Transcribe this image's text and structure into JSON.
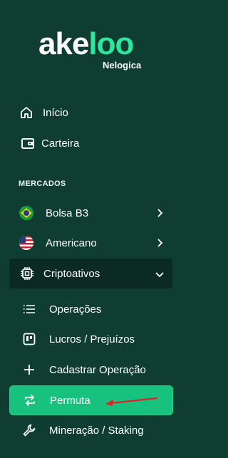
{
  "brand": {
    "logo_word_a": "ake",
    "logo_word_b": "loo",
    "logo_sub": "Nelogica",
    "accent": "#2ee59d"
  },
  "nav": {
    "inicio": {
      "label": "Início",
      "icon": "home-icon"
    },
    "carteira": {
      "label": "Carteira",
      "icon": "wallet-icon"
    }
  },
  "mercados": {
    "title": "MERCADOS",
    "items": [
      {
        "label": "Bolsa B3",
        "icon": "brazil-flag-icon"
      },
      {
        "label": "Americano",
        "icon": "usa-flag-icon"
      },
      {
        "label": "Criptoativos",
        "icon": "chip-icon"
      }
    ]
  },
  "crypto_sub": [
    {
      "label": "Operações",
      "icon": "list-icon"
    },
    {
      "label": "Lucros / Prejuízos",
      "icon": "board-icon"
    },
    {
      "label": "Cadastrar Operação",
      "icon": "plus-icon"
    },
    {
      "label": "Permuta",
      "icon": "swap-icon"
    },
    {
      "label": "Mineração / Staking",
      "icon": "wrench-icon"
    }
  ],
  "colors": {
    "background": "#0f3d31",
    "active_item": "#17c27f",
    "expanded_item": "#0b2a21",
    "annotation_arrow": "#e0212b"
  }
}
